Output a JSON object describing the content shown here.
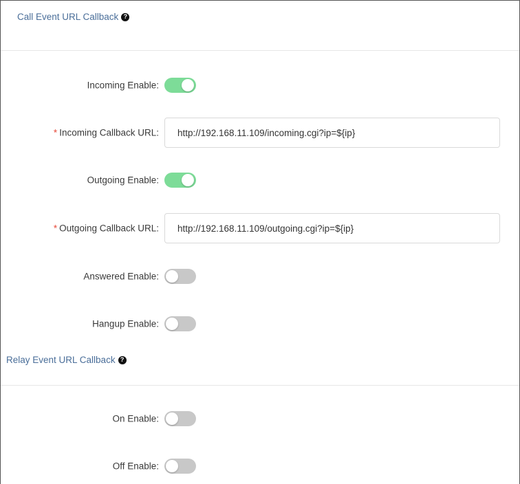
{
  "call_section": {
    "title": "Call Event URL Callback",
    "help_icon": "question-circle-icon",
    "incoming_enable": {
      "label": "Incoming Enable:",
      "on": true
    },
    "incoming_url": {
      "required_mark": "*",
      "label": "Incoming Callback URL:",
      "value": "http://192.168.11.109/incoming.cgi?ip=${ip}"
    },
    "outgoing_enable": {
      "label": "Outgoing Enable:",
      "on": true
    },
    "outgoing_url": {
      "required_mark": "*",
      "label": "Outgoing Callback URL:",
      "value": "http://192.168.11.109/outgoing.cgi?ip=${ip}"
    },
    "answered_enable": {
      "label": "Answered Enable:",
      "on": false
    },
    "hangup_enable": {
      "label": "Hangup Enable:",
      "on": false
    }
  },
  "relay_section": {
    "title": "Relay Event URL Callback",
    "help_icon": "question-circle-icon",
    "on_enable": {
      "label": "On Enable:",
      "on": false
    },
    "off_enable": {
      "label": "Off Enable:",
      "on": false
    }
  },
  "colors": {
    "toggle_on": "#7ddc98",
    "toggle_off": "#c8c8c8",
    "section_title": "#4a6e99",
    "required": "#e74c3c"
  }
}
